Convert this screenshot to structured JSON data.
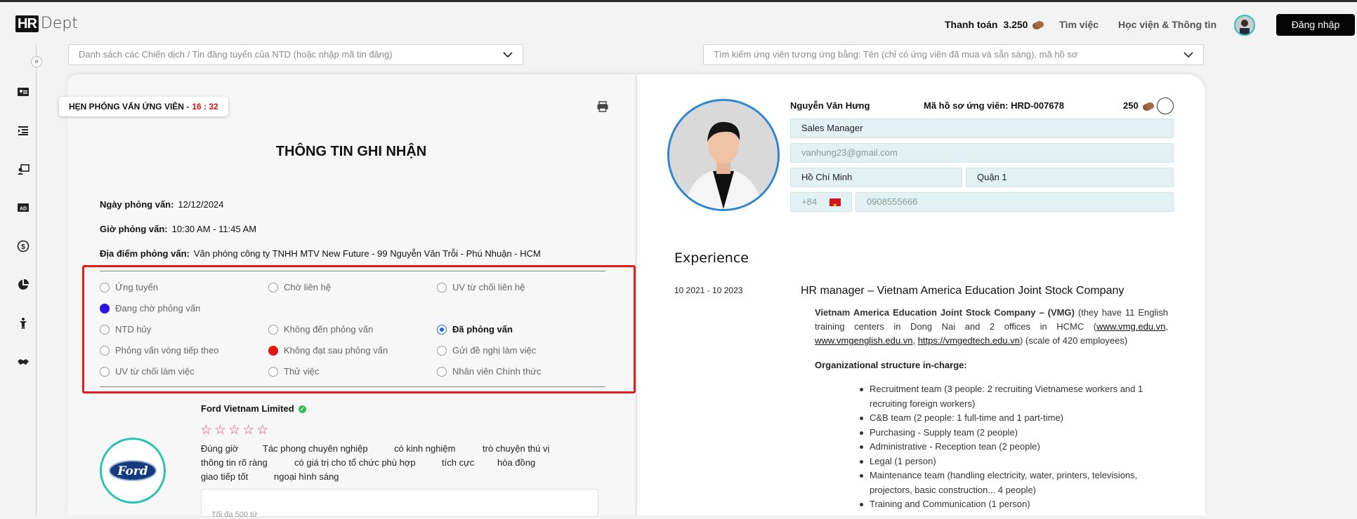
{
  "header": {
    "logo_mark": "HR",
    "logo_text": "Dept",
    "payment_label": "Thanh toán",
    "payment_amount": "3.250",
    "nav_find_jobs": "Tìm việc",
    "nav_academy": "Học viện & Thông tin",
    "login_label": "Đăng nhập",
    "coin_color": "#8a5a3c",
    "accent_color": "#27c2b4"
  },
  "sidebar": {
    "collapse_icon": "»",
    "icons": [
      "id-card-icon",
      "list-indent-icon",
      "interview-icon",
      "ad-icon",
      "dollar-icon",
      "pie-chart-icon",
      "person-icon",
      "handshake-icon"
    ]
  },
  "search": {
    "campaign_placeholder": "Danh sách các Chiến dịch / Tin đăng tuyển của NTD (hoặc nhập mã tin đăng)",
    "candidate_placeholder": "Tìm kiếm ứng viên tương ứng bằng: Tên (chỉ có ứng viên đã mua và sẵn sàng), mã hồ sơ"
  },
  "interview": {
    "badge_label": "HẸN PHỎNG VẤN ỨNG VIÊN -",
    "badge_time": "16 : 32",
    "title": "THÔNG TIN GHI NHẬN",
    "date_label": "Ngày phỏng vấn:",
    "date_value": "12/12/2024",
    "time_label": "Giờ phỏng vấn:",
    "time_value": "10:30 AM - 11:45 AM",
    "location_label": "Địa điểm phỏng vấn:",
    "location_value": "Văn phòng công ty TNHH MTV New Future - 99 Nguyễn Văn Trỗi - Phú Nhuận - HCM"
  },
  "statuses": {
    "s1": "Ứng tuyển",
    "s2": "Chờ liên hệ",
    "s3": "UV từ chối liên hệ",
    "s4": "Đang chờ phỏng vấn",
    "s5": "NTD hủy",
    "s6": "Không đến phỏng vấn",
    "s7": "Đã phỏng vấn",
    "s8": "Phỏng vấn vòng tiếp theo",
    "s9": "Không đạt sau phỏng vấn",
    "s10": "Gửi đề nghị làm việc",
    "s11": "UV từ chối làm việc",
    "s12": "Thử việc",
    "s13": "Nhân viên Chính thức",
    "selected": "Đã phỏng vấn",
    "colors": {
      "waiting": "#2b14e6",
      "failed": "#e81212",
      "selected": "#1f66d8"
    }
  },
  "company": {
    "name": "Ford Vietnam Limited",
    "logo_text": "Ford",
    "rating": 0,
    "rating_max": 5,
    "tags": [
      "Đúng giờ",
      "Tác phong chuyên nghiệp",
      "có kinh nghiệm",
      "trò chuyện thú vị",
      "thông tin rõ ràng",
      "có giá trị cho tổ chức phù hợp",
      "tích cực",
      "hòa đồng",
      "giao tiếp tốt",
      "ngoại hình sáng"
    ],
    "notes_placeholder": "Tối đa 500 từ"
  },
  "candidate": {
    "name": "Nguyễn Văn Hưng",
    "code": "Mã hồ sơ ứng viên: HRD-007678",
    "price": "250",
    "position": "Sales Manager",
    "email": "vanhung23@gmail.com",
    "city": "Hồ Chí Minh",
    "district": "Quận 1",
    "phone_code": "+84",
    "phone": "0908555666"
  },
  "experience": {
    "heading": "Experience",
    "period": "10 2021 - 10 2023",
    "role": "HR manager  – Vietnam America Education Joint Stock Company",
    "desc_bold": "Vietnam America Education Joint Stock Company – (VMG)",
    "desc_1": " (they have 11 English training centers in Dong Nai and 2 offices in HCMC (",
    "link_1": "www.vmg.edu.vn",
    "sep_1": ", ",
    "link_2": "www.vmgenglish.edu.vn",
    "sep_2": ", ",
    "link_3": "https://vmgedtech.edu.vn",
    "desc_2": ") (scale of 420 employees)",
    "structure_heading": "Organizational structure in-charge:",
    "items": [
      "Recruitment team (3 people: 2 recruiting Vietnamese workers and 1 recruiting foreign workers)",
      "C&B team (2 people: 1 full-time and 1 part-time)",
      "Purchasing - Supply team (2 people)",
      "Administrative - Reception tean (2 people)",
      "Legal (1 person)",
      "Maintenance team (handling electricity, water, printers, televisions, projectors, basic construction... 4 people)",
      "Training and Communication (1 person)"
    ]
  }
}
